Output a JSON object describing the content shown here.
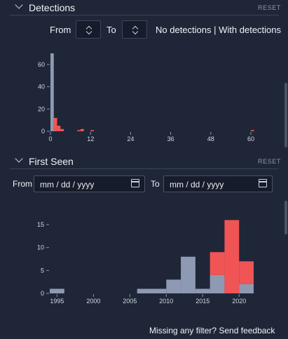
{
  "detections": {
    "title": "Detections",
    "reset_label": "RESET",
    "from_label": "From",
    "to_label": "To",
    "option_no": "No detections",
    "separator": "|",
    "option_with": "With detections",
    "chart": {
      "y_ticks": [
        "60",
        "40",
        "20",
        "0"
      ],
      "x_ticks": [
        "0",
        "12",
        "24",
        "36",
        "48",
        "60"
      ]
    }
  },
  "first_seen": {
    "title": "First Seen",
    "reset_label": "RESET",
    "from_label": "From",
    "to_label": "To",
    "from_placeholder": "mm / dd / yyyy",
    "to_placeholder": "mm / dd / yyyy",
    "chart": {
      "y_ticks": [
        "15",
        "10",
        "5",
        "0"
      ],
      "x_ticks": [
        "1995",
        "2000",
        "2005",
        "2010",
        "2015",
        "2020"
      ]
    }
  },
  "footer": {
    "feedback_text": "Missing any filter? Send feedback"
  },
  "colors": {
    "background": "#1f2638",
    "no_detections_series": "#8e9ab3",
    "with_detections_series": "#f05455"
  },
  "chart_data": [
    {
      "type": "bar",
      "title": "",
      "xlabel": "",
      "ylabel": "",
      "xlim": [
        0,
        60
      ],
      "ylim": [
        0,
        70
      ],
      "bins": [
        {
          "x0": 0,
          "x1": 1,
          "no": 70,
          "with": 0
        },
        {
          "x0": 1,
          "x1": 2,
          "no": 0,
          "with": 12
        },
        {
          "x0": 2,
          "x1": 3,
          "no": 0,
          "with": 5
        },
        {
          "x0": 3,
          "x1": 4,
          "no": 0,
          "with": 2
        },
        {
          "x0": 8,
          "x1": 9,
          "no": 0,
          "with": 1
        },
        {
          "x0": 9,
          "x1": 10,
          "no": 0,
          "with": 2
        },
        {
          "x0": 12,
          "x1": 13,
          "no": 0,
          "with": 1
        },
        {
          "x0": 60,
          "x1": 61,
          "no": 0,
          "with": 1
        }
      ]
    },
    {
      "type": "bar",
      "title": "",
      "xlabel": "",
      "ylabel": "",
      "xlim": [
        1994,
        2022
      ],
      "ylim": [
        0,
        17
      ],
      "bins": [
        {
          "x0": 1994,
          "x1": 1996,
          "no": 1,
          "with": 0
        },
        {
          "x0": 2006,
          "x1": 2010,
          "no": 1,
          "with": 0
        },
        {
          "x0": 2010,
          "x1": 2012,
          "no": 3,
          "with": 0
        },
        {
          "x0": 2012,
          "x1": 2014,
          "no": 8,
          "with": 0
        },
        {
          "x0": 2014,
          "x1": 2016,
          "no": 1,
          "with": 0
        },
        {
          "x0": 2016,
          "x1": 2018,
          "no": 4,
          "with": 5
        },
        {
          "x0": 2018,
          "x1": 2020,
          "no": 0,
          "with": 16
        },
        {
          "x0": 2020,
          "x1": 2022,
          "no": 2,
          "with": 5
        }
      ]
    }
  ]
}
